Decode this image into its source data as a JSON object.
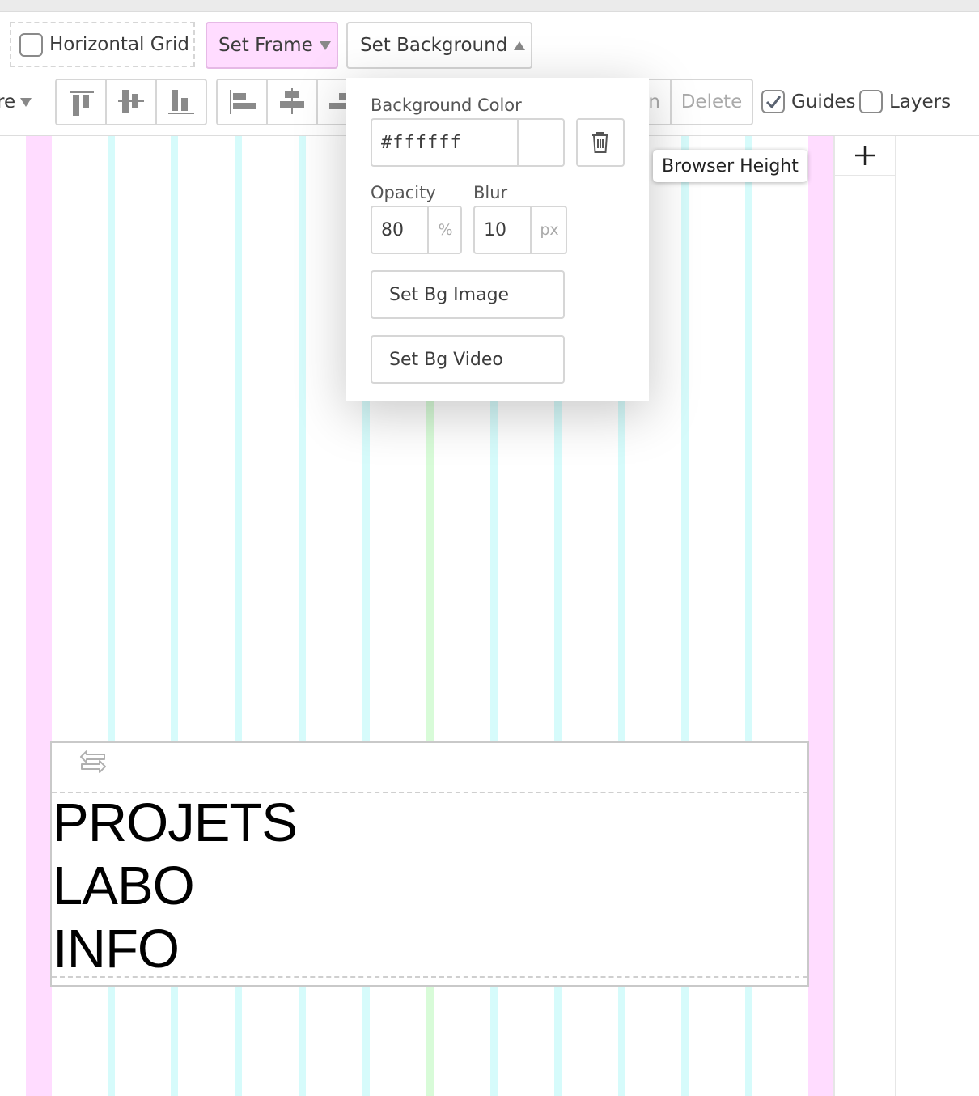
{
  "toolbar": {
    "horizontal_grid_label": "Horizontal Grid",
    "horizontal_grid_checked": false,
    "set_frame_label": "Set Frame",
    "set_background_label": "Set Background",
    "partial_dropdown_label": "re",
    "partial_button_label": "n",
    "delete_label": "Delete",
    "guides_label": "Guides",
    "guides_checked": true,
    "layers_label": "Layers",
    "layers_checked": false
  },
  "background_popup": {
    "color_label": "Background Color",
    "color_value": "#ffffff",
    "opacity_label": "Opacity",
    "opacity_value": "80",
    "opacity_unit": "%",
    "blur_label": "Blur",
    "blur_value": "10",
    "blur_unit": "px",
    "bg_image_button": "Set Bg Image",
    "bg_video_button": "Set Bg Video"
  },
  "canvas": {
    "tooltip": "Browser Height",
    "add_label": "+",
    "menu_items": [
      "PROJETS",
      "LABO",
      "INFO"
    ]
  },
  "colors": {
    "frame_button_bg": "#ffdcff",
    "outer_column": "#ffdcff",
    "grid_column": "#d6fbfb",
    "center_column": "#d8fbd8"
  },
  "icons": [
    "align-top-icon",
    "align-middle-icon",
    "align-bottom-icon",
    "align-left-icon",
    "align-center-icon",
    "align-right-icon",
    "checkmark-icon",
    "trash-icon",
    "move-arrows-icon",
    "plus-icon"
  ]
}
